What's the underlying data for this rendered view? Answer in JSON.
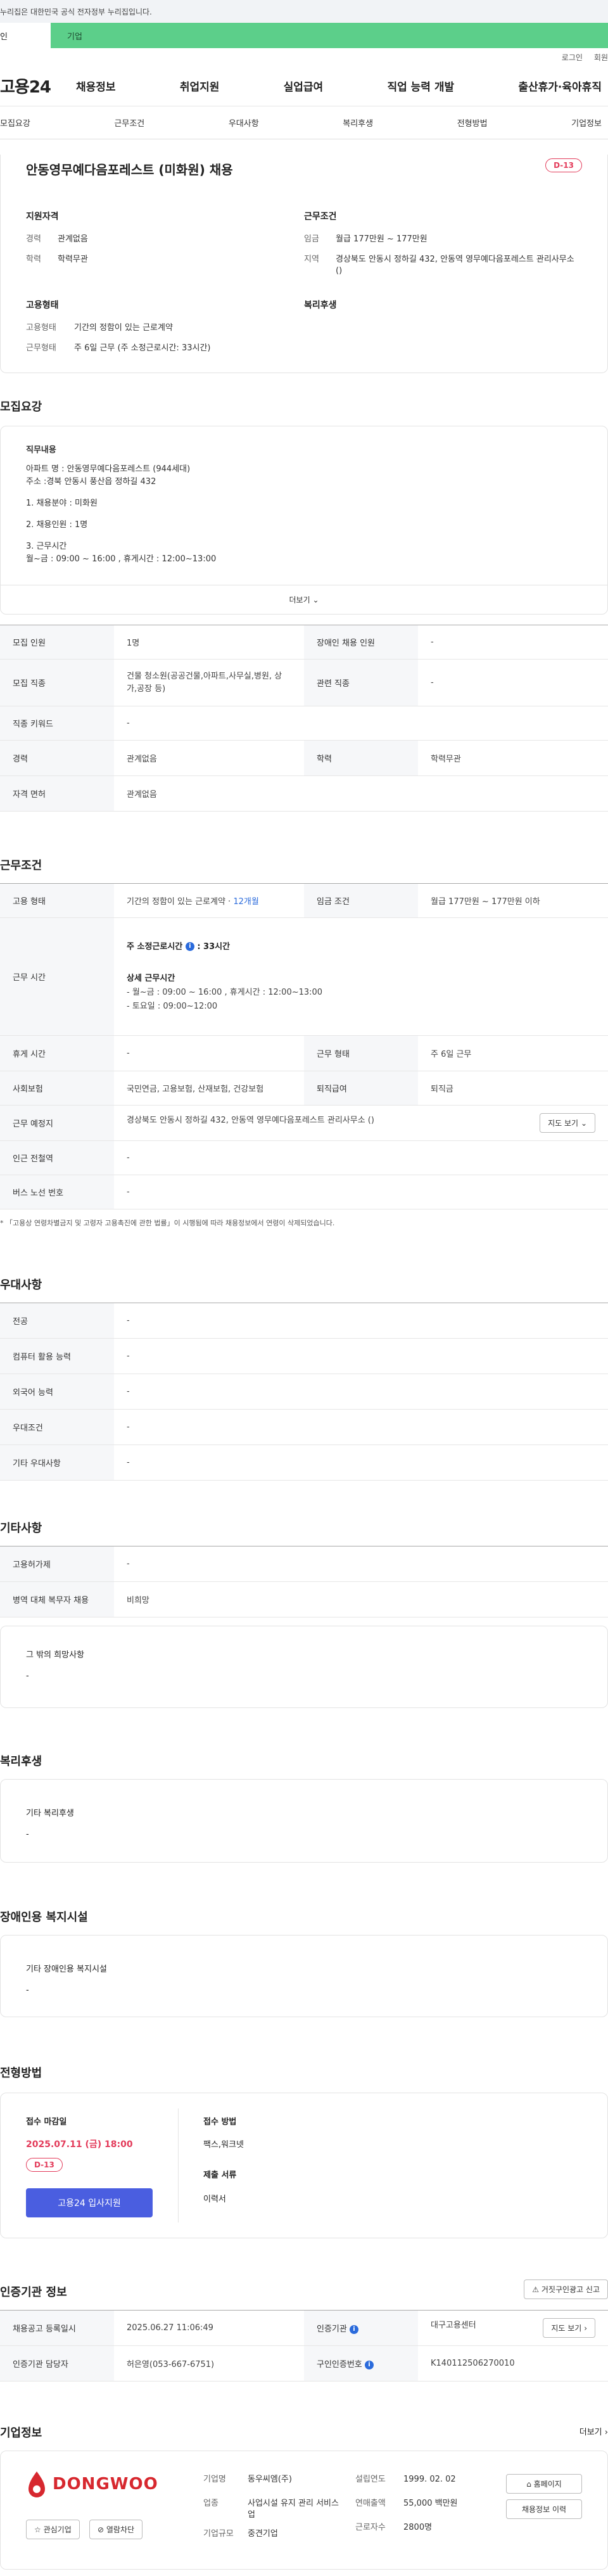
{
  "gov_banner": "누리집은 대한민국 공식 전자정부 누리집입니다.",
  "category_tabs": [
    "인",
    "기업"
  ],
  "util_links": [
    "로그인",
    "회원"
  ],
  "logo": "고용24",
  "gnb": [
    "채용정보",
    "취업지원",
    "실업급여",
    "직업 능력 개발",
    "출산휴가·육아휴직"
  ],
  "subtabs": [
    "모집요강",
    "근무조건",
    "우대사항",
    "복리후생",
    "전형방법",
    "기업정보"
  ],
  "summary": {
    "title": "안동영무예다음포레스트 (미화원) 채용",
    "dday": "D-13",
    "qual_title": "지원자격",
    "career_k": "경력",
    "career_v": "관계없음",
    "edu_k": "학력",
    "edu_v": "학력무관",
    "cond_title": "근무조건",
    "wage_k": "임금",
    "wage_v": "월급 177만원 ~ 177만원",
    "area_k": "지역",
    "area_v": "경상북도 안동시 정하길 432, 안동역 영무예다음포레스트 관리사무소 ()",
    "emp_title": "고용형태",
    "emptype_k": "고용형태",
    "emptype_v": "기간의 정함이 있는 근로계약",
    "worktype_k": "근무형태",
    "worktype_v": "주 6일 근무 (주 소정근로시간: 33시간)",
    "welfare_title": "복리후생"
  },
  "recruit": {
    "title": "모집요강",
    "desc_title": "직무내용",
    "desc_lines": [
      "아파트 명 :   안동영무예다음포레스트 (944세대)",
      "주소 :경북 안동시 풍산읍 정하길 432",
      "",
      "1. 채용분야 :  미화원",
      "",
      "2. 채용인원 : 1명",
      "",
      "3. 근무시간",
      "  월~금 : 09:00 ~ 16:00 , 휴게시간 : 12:00~13:00"
    ],
    "more": "더보기",
    "rows": [
      [
        "모집 인원",
        "1명",
        "장애인 채용 인원",
        "-"
      ],
      [
        "모집 직종",
        "건물 청소원(공공건물,아파트,사무실,병원, 상가,공장 등)",
        "관련 직종",
        "-"
      ],
      [
        "직종 키워드",
        "-"
      ],
      [
        "경력",
        "관계없음",
        "학력",
        "학력무관"
      ],
      [
        "자격 면허",
        "관계없음"
      ]
    ]
  },
  "conditions": {
    "title": "근무조건",
    "emp_k": "고용 형태",
    "emp_v": "기간의 정함이 있는 근로계약 · ",
    "emp_months": "12개월",
    "wage_k": "임금 조건",
    "wage_v": "월급 177만원 ~ 177만원 이하",
    "hours_k": "근무 시간",
    "hours_total": "주 소정근로시간 ",
    "hours_total_val": ": 33시간",
    "hours_detail_title": "상세 근무시간",
    "hours_detail": [
      "- 월~금 : 09:00 ~ 16:00 , 휴게시간 : 12:00~13:00",
      "- 토요일 : 09:00~12:00"
    ],
    "rest_k": "휴게 시간",
    "rest_v": "-",
    "form_k": "근무 형태",
    "form_v": "주 6일 근무",
    "ins_k": "사회보험",
    "ins_v": "국민연금, 고용보험, 산재보험, 건강보험",
    "sev_k": "퇴직급여",
    "sev_v": "퇴직금",
    "place_k": "근무 예정지",
    "place_v": "경상북도 안동시 정하길 432, 안동역 영무예다음포레스트 관리사무소 ()",
    "map_btn": "지도 보기",
    "station_k": "인근 전철역",
    "station_v": "-",
    "bus_k": "버스 노선 번호",
    "bus_v": "-",
    "note": "* 「고용상 연령차별금지 및 고령자 고용촉진에 관한 법률」이 시행됨에 따라 채용정보에서 연령이 삭제되었습니다."
  },
  "preferences": {
    "title": "우대사항",
    "rows": [
      [
        "전공",
        "-"
      ],
      [
        "컴퓨터 활용 능력",
        "-"
      ],
      [
        "외국어 능력",
        "-"
      ],
      [
        "우대조건",
        "-"
      ],
      [
        "기타 우대사항",
        "-"
      ]
    ]
  },
  "etc": {
    "title": "기타사항",
    "rows": [
      [
        "고용허가제",
        "-"
      ],
      [
        "병역 대체 복무자 채용",
        "비희망"
      ]
    ],
    "wish_title": "그 밖의 희망사항",
    "wish_v": "-"
  },
  "welfare": {
    "title": "복리후생",
    "box_title": "기타 복리후생",
    "box_v": "-"
  },
  "disabled": {
    "title": "장애인용 복지시설",
    "box_title": "기타 장애인용 복지시설",
    "box_v": "-"
  },
  "selection": {
    "title": "전형방법",
    "deadline_k": "접수 마감일",
    "deadline_v": "2025.07.11 (금) 18:00",
    "dday": "D-13",
    "apply_btn": "고용24 입사지원",
    "method_k": "접수 방법",
    "method_v": "팩스,워크넷",
    "docs_k": "제출 서류",
    "docs_v": "이력서"
  },
  "agency": {
    "title": "인증기관 정보",
    "report_btn": "거짓구인광고 신고",
    "reg_k": "채용공고 등록일시",
    "reg_v": "2025.06.27 11:06:49",
    "org_k": "인증기관",
    "org_v": "대구고용센터",
    "map_btn": "지도 보기",
    "mgr_k": "인증기관 담당자",
    "mgr_v": "허은영(053-667-6751)",
    "no_k": "구인인증번호",
    "no_v": "K140112506270010"
  },
  "company": {
    "title": "기업정보",
    "more": "더보기",
    "logo_text": "DONGWOO",
    "fav_btn": "관심기업",
    "block_btn": "열람차단",
    "name_k": "기업명",
    "name_v": "동우씨엠(주)",
    "ind_k": "업종",
    "ind_v": "사업시설 유지 관리 서비스업",
    "size_k": "기업규모",
    "size_v": "중견기업",
    "est_k": "설립연도",
    "est_v": "1999. 02. 02",
    "sales_k": "연매출액",
    "sales_v": "55,000 백만원",
    "emp_k": "근로자수",
    "emp_v": "2800명",
    "home_btn": "홈페이지",
    "jobs_btn": "채용정보 이력"
  }
}
